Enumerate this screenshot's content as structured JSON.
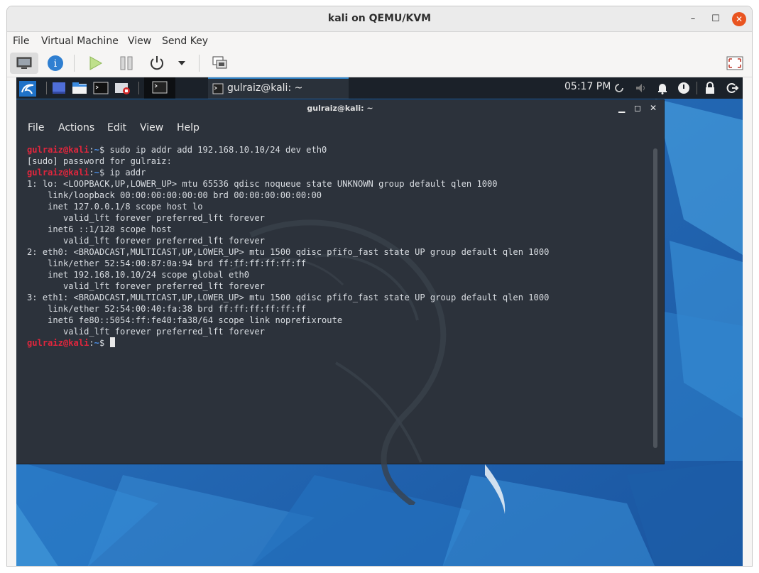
{
  "window": {
    "title": "kali on QEMU/KVM",
    "minimize_icon": "minimize-icon",
    "maximize_icon": "maximize-icon",
    "close_icon": "close-icon"
  },
  "menubar": [
    "File",
    "Virtual Machine",
    "View",
    "Send Key"
  ],
  "toolbar": {
    "icons": [
      "console-icon",
      "details-icon",
      "run-icon",
      "pause-icon",
      "power-icon",
      "dropdown-icon",
      "snapshot-icon",
      "fullscreen-icon"
    ]
  },
  "guest_panel": {
    "task_label": "gulraiz@kali: ~",
    "clock": "05:17 PM",
    "icons": [
      "kali-menu-icon",
      "workspace-icon",
      "files-icon",
      "terminal-icon",
      "recorder-icon",
      "terminal-window-icon",
      "network-icon",
      "volume-icon",
      "notifications-icon",
      "power-manager-icon",
      "lock-icon",
      "logout-icon"
    ]
  },
  "terminal": {
    "title": "gulraiz@kali: ~",
    "menu": [
      "File",
      "Actions",
      "Edit",
      "View",
      "Help"
    ],
    "prompt_user": "gulraiz@kali",
    "prompt_sep": ":",
    "prompt_dir": "~",
    "prompt_end": "$ ",
    "lines": [
      {
        "type": "cmd",
        "text": "sudo ip addr add 192.168.10.10/24 dev eth0"
      },
      {
        "type": "out",
        "text": "[sudo] password for gulraiz:"
      },
      {
        "type": "cmd",
        "text": "ip addr"
      },
      {
        "type": "out",
        "text": "1: lo: <LOOPBACK,UP,LOWER_UP> mtu 65536 qdisc noqueue state UNKNOWN group default qlen 1000"
      },
      {
        "type": "out",
        "text": "    link/loopback 00:00:00:00:00:00 brd 00:00:00:00:00:00"
      },
      {
        "type": "out",
        "text": "    inet 127.0.0.1/8 scope host lo"
      },
      {
        "type": "out",
        "text": "       valid_lft forever preferred_lft forever"
      },
      {
        "type": "out",
        "text": "    inet6 ::1/128 scope host"
      },
      {
        "type": "out",
        "text": "       valid_lft forever preferred_lft forever"
      },
      {
        "type": "out",
        "text": "2: eth0: <BROADCAST,MULTICAST,UP,LOWER_UP> mtu 1500 qdisc pfifo_fast state UP group default qlen 1000"
      },
      {
        "type": "out",
        "text": "    link/ether 52:54:00:87:0a:94 brd ff:ff:ff:ff:ff:ff"
      },
      {
        "type": "out",
        "text": "    inet 192.168.10.10/24 scope global eth0"
      },
      {
        "type": "out",
        "text": "       valid_lft forever preferred_lft forever"
      },
      {
        "type": "out",
        "text": "3: eth1: <BROADCAST,MULTICAST,UP,LOWER_UP> mtu 1500 qdisc pfifo_fast state UP group default qlen 1000"
      },
      {
        "type": "out",
        "text": "    link/ether 52:54:00:40:fa:38 brd ff:ff:ff:ff:ff:ff"
      },
      {
        "type": "out",
        "text": "    inet6 fe80::5054:ff:fe40:fa38/64 scope link noprefixroute"
      },
      {
        "type": "out",
        "text": "       valid_lft forever preferred_lft forever"
      },
      {
        "type": "prompt",
        "text": ""
      }
    ]
  },
  "colors": {
    "prompt_user": "#e0263d",
    "prompt_dir": "#4b8ee6",
    "terminal_bg": "#2c323b",
    "desktop_bg": "#1f5fa6",
    "close_button": "#e95420"
  }
}
